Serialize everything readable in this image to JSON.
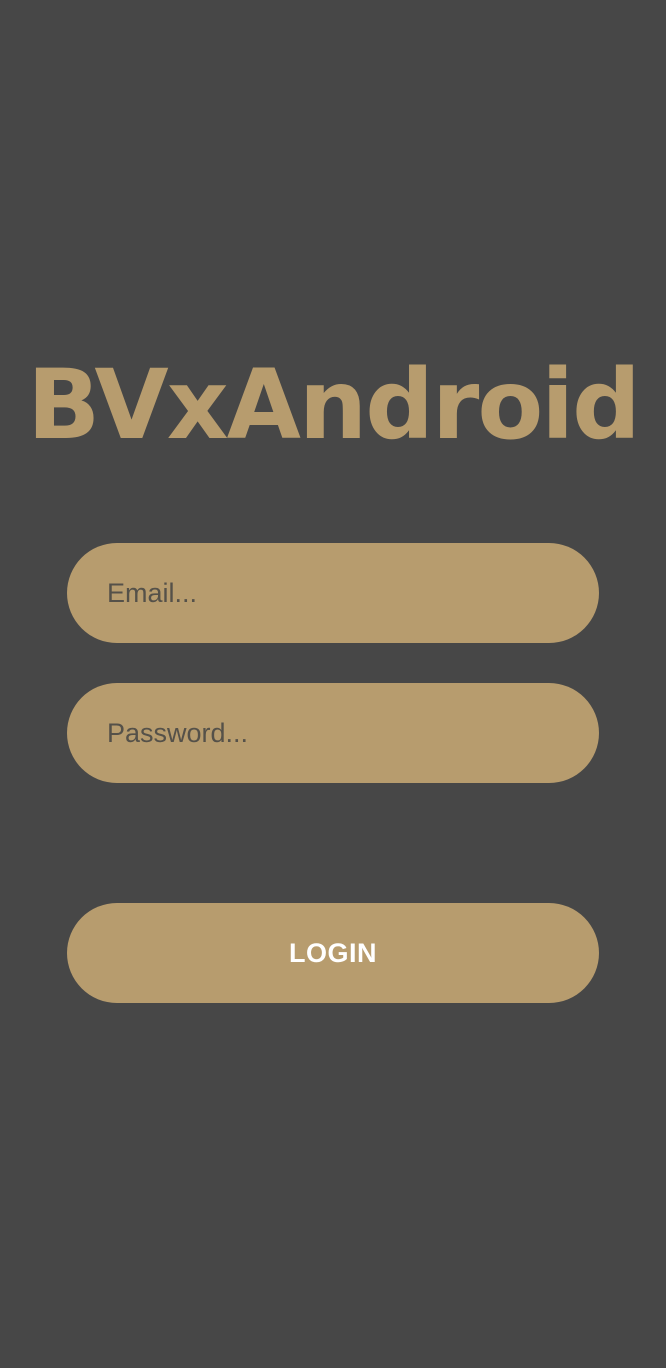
{
  "app": {
    "title": "BVxAndroid"
  },
  "form": {
    "email": {
      "placeholder": "Email...",
      "value": ""
    },
    "password": {
      "placeholder": "Password...",
      "value": ""
    },
    "login_label": "LOGIN"
  },
  "colors": {
    "background": "#474747",
    "accent": "#b79c6e",
    "button_text": "#ffffff",
    "placeholder_text": "#555149"
  }
}
